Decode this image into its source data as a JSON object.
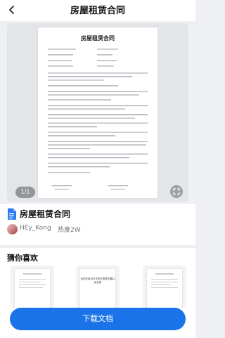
{
  "header": {
    "title": "房屋租赁合同",
    "back_icon": "chevron-left-icon"
  },
  "preview": {
    "doc_title": "房屋租赁合同",
    "page_counter": "1/1",
    "expand_icon": "expand-icon"
  },
  "document": {
    "name": "房屋租赁合同",
    "file_icon": "word-file-icon",
    "author": "HEy_Kong",
    "heat": "热度2W"
  },
  "recommend": {
    "title": "猜你喜欢",
    "cards": [
      {
        "text": ""
      },
      {
        "text": "合同交给对方手时代表签字确认后生效"
      },
      {
        "text": ""
      }
    ]
  },
  "download": {
    "label": "下载文档"
  },
  "colors": {
    "accent": "#1a73e8",
    "background": "#eef0f3"
  }
}
